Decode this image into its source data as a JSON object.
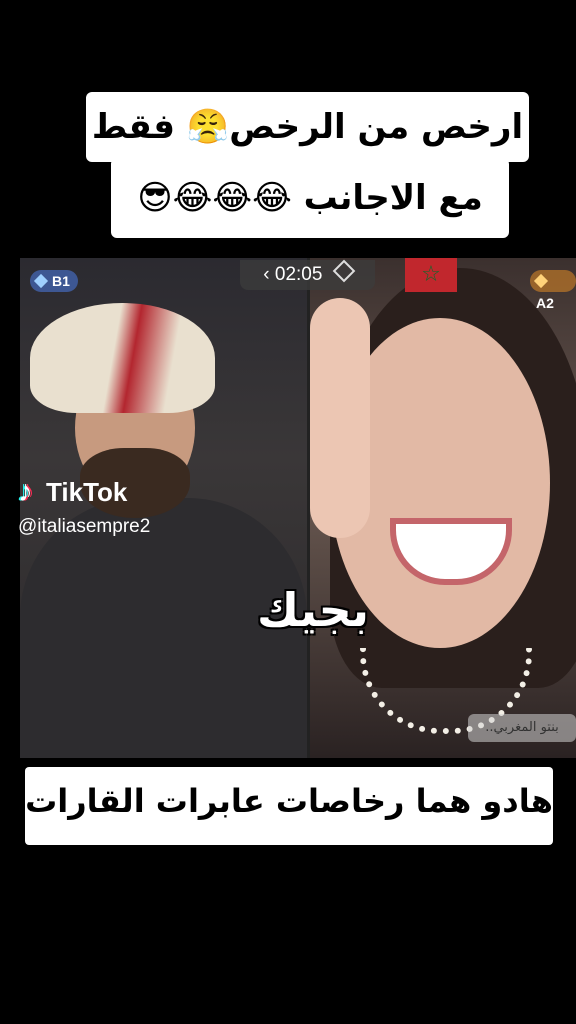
{
  "captions": {
    "top_line_1": "ارخص من الرخص😤 فقط",
    "top_line_2": "مع الاجانب 😂😂😂😎",
    "bottom": "هادو هما رخاصات عابرات القارات"
  },
  "live_battle": {
    "timer": "02:05",
    "left_badge": "B1",
    "right_badge": "A2",
    "subtitle": "بجيك",
    "right_name_tag": "بنتو المغربي.."
  },
  "watermark": {
    "brand": "TikTok",
    "handle": "@italiasempre2"
  },
  "icons": {
    "flag": "morocco-flag-icon",
    "badge": "diamond-icon",
    "back": "chevron-left-icon"
  },
  "colors": {
    "background": "#000000",
    "caption_bg": "#ffffff",
    "flag_red": "#c1272d",
    "flag_green": "#0b6b2d"
  }
}
